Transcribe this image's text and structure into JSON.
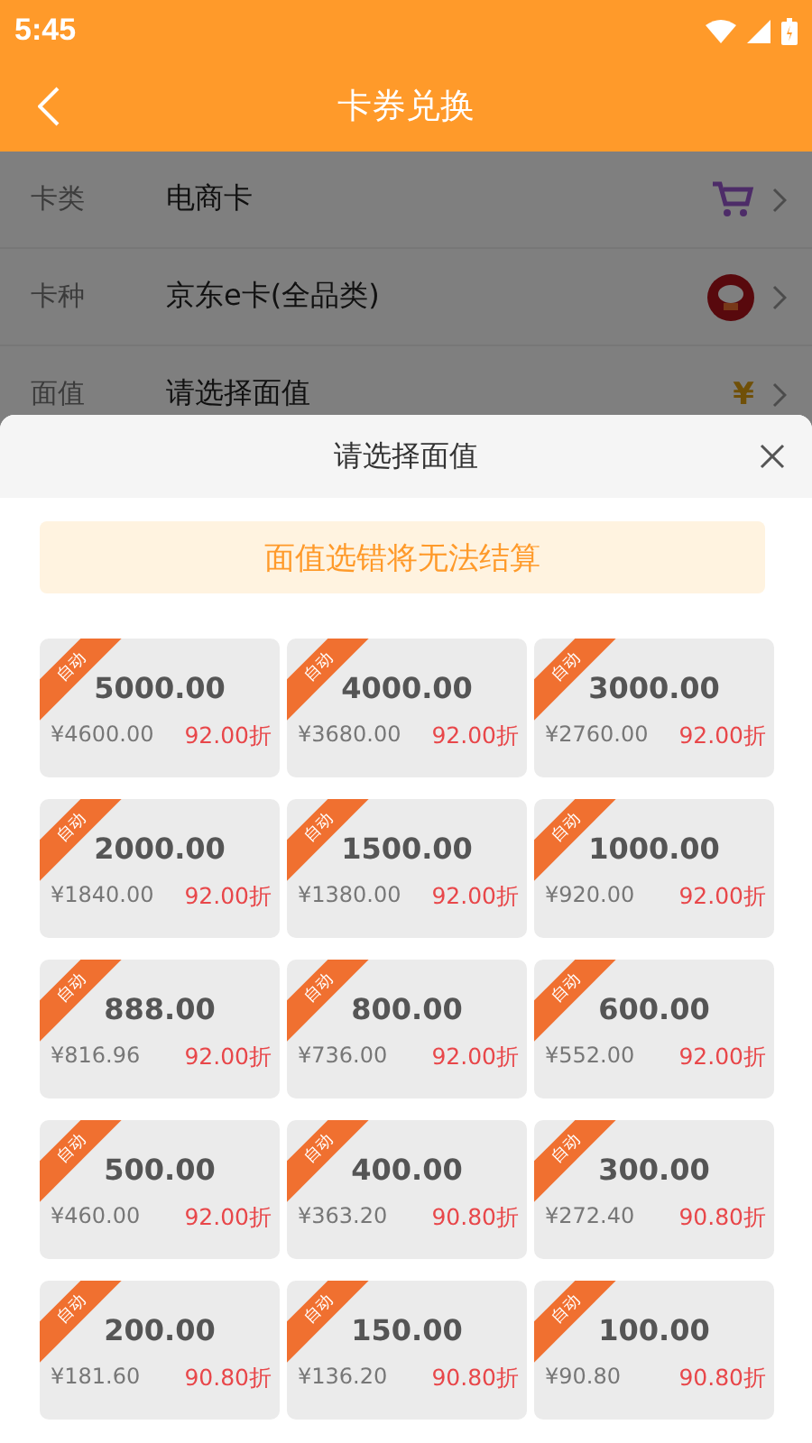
{
  "status_bar": {
    "time": "5:45"
  },
  "header": {
    "title": "卡券兑换"
  },
  "form_rows": [
    {
      "label": "卡类",
      "value": "电商卡",
      "kind": "cart"
    },
    {
      "label": "卡种",
      "value": "京东e卡(全品类)",
      "kind": "logo"
    },
    {
      "label": "面值",
      "value": "请选择面值",
      "kind": "glyph",
      "glyph": "¥"
    }
  ],
  "sheet": {
    "title": "请选择面值",
    "notice": "面值选错将无法结算",
    "cards": [
      {
        "tag": "自动",
        "amount": "5000.00",
        "price": "¥4600.00",
        "discount": "92.00折"
      },
      {
        "tag": "自动",
        "amount": "4000.00",
        "price": "¥3680.00",
        "discount": "92.00折"
      },
      {
        "tag": "自动",
        "amount": "3000.00",
        "price": "¥2760.00",
        "discount": "92.00折"
      },
      {
        "tag": "自动",
        "amount": "2000.00",
        "price": "¥1840.00",
        "discount": "92.00折"
      },
      {
        "tag": "自动",
        "amount": "1500.00",
        "price": "¥1380.00",
        "discount": "92.00折"
      },
      {
        "tag": "自动",
        "amount": "1000.00",
        "price": "¥920.00",
        "discount": "92.00折"
      },
      {
        "tag": "自动",
        "amount": "888.00",
        "price": "¥816.96",
        "discount": "92.00折"
      },
      {
        "tag": "自动",
        "amount": "800.00",
        "price": "¥736.00",
        "discount": "92.00折"
      },
      {
        "tag": "自动",
        "amount": "600.00",
        "price": "¥552.00",
        "discount": "92.00折"
      },
      {
        "tag": "自动",
        "amount": "500.00",
        "price": "¥460.00",
        "discount": "92.00折"
      },
      {
        "tag": "自动",
        "amount": "400.00",
        "price": "¥363.20",
        "discount": "90.80折"
      },
      {
        "tag": "自动",
        "amount": "300.00",
        "price": "¥272.40",
        "discount": "90.80折"
      },
      {
        "tag": "自动",
        "amount": "200.00",
        "price": "¥181.60",
        "discount": "90.80折"
      },
      {
        "tag": "自动",
        "amount": "150.00",
        "price": "¥136.20",
        "discount": "90.80折"
      },
      {
        "tag": "自动",
        "amount": "100.00",
        "price": "¥90.80",
        "discount": "90.80折"
      }
    ]
  }
}
